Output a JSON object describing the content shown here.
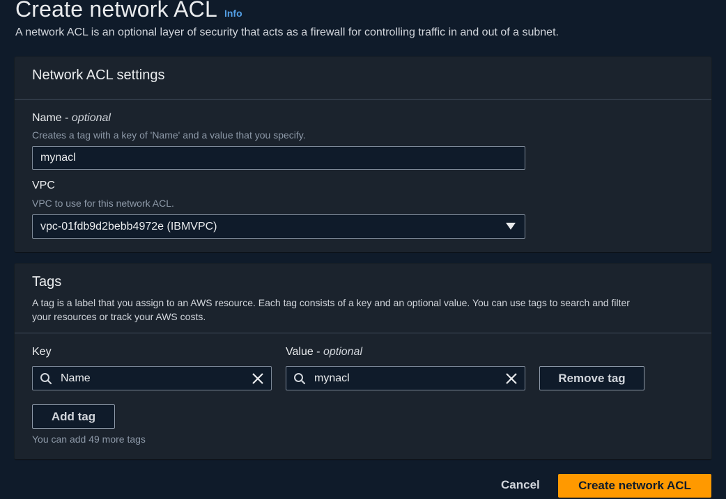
{
  "header": {
    "title": "Create network ACL",
    "info": "Info",
    "description": "A network ACL is an optional layer of security that acts as a firewall for controlling traffic in and out of a subnet."
  },
  "settings": {
    "title": "Network ACL settings",
    "name_label": "Name - ",
    "name_optional": "optional",
    "name_hint": "Creates a tag with a key of 'Name' and a value that you specify.",
    "name_value": "mynacl",
    "vpc_label": "VPC",
    "vpc_hint": "VPC to use for this network ACL.",
    "vpc_value": "vpc-01fdb9d2bebb4972e (IBMVPC)"
  },
  "tags": {
    "title": "Tags",
    "description_line1": "A tag is a label that you assign to an AWS resource. Each tag consists of a key and an optional value. You can use tags to search and filter",
    "description_line2": "your resources or track your AWS costs.",
    "key_label": "Key",
    "value_label": "Value - ",
    "value_optional": "optional",
    "rows": [
      {
        "key": "Name",
        "value": "mynacl"
      }
    ],
    "remove_label": "Remove tag",
    "add_label": "Add tag",
    "remaining": "You can add 49 more tags"
  },
  "footer": {
    "cancel": "Cancel",
    "create": "Create network ACL"
  },
  "colors": {
    "background": "#0f1b2a",
    "panel": "#1b232d",
    "primary": "#ff9900",
    "link": "#539fe5"
  }
}
